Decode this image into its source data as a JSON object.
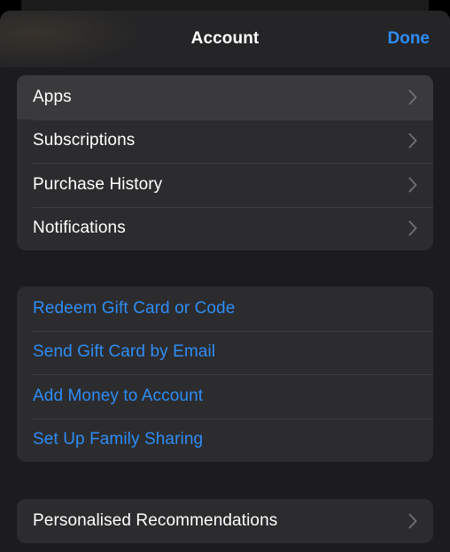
{
  "header": {
    "title": "Account",
    "done_label": "Done"
  },
  "groups": [
    {
      "items": [
        {
          "label": "Apps",
          "chevron": "chevron-right-icon"
        },
        {
          "label": "Subscriptions",
          "chevron": "chevron-right-icon"
        },
        {
          "label": "Purchase History",
          "chevron": "chevron-right-icon"
        },
        {
          "label": "Notifications",
          "chevron": "chevron-right-icon"
        }
      ]
    },
    {
      "items": [
        {
          "label": "Redeem Gift Card or Code"
        },
        {
          "label": "Send Gift Card by Email"
        },
        {
          "label": "Add Money to Account"
        },
        {
          "label": "Set Up Family Sharing"
        }
      ]
    },
    {
      "items": [
        {
          "label": "Personalised Recommendations",
          "chevron": "chevron-right-icon"
        }
      ]
    }
  ],
  "colors": {
    "background": "#000000",
    "sheet": "#1c1c1e",
    "cell": "#2c2c2e",
    "cell_highlight": "#3a3a3c",
    "accent": "#2f8cf4",
    "text": "#ffffff",
    "chevron": "#6d6d72"
  }
}
